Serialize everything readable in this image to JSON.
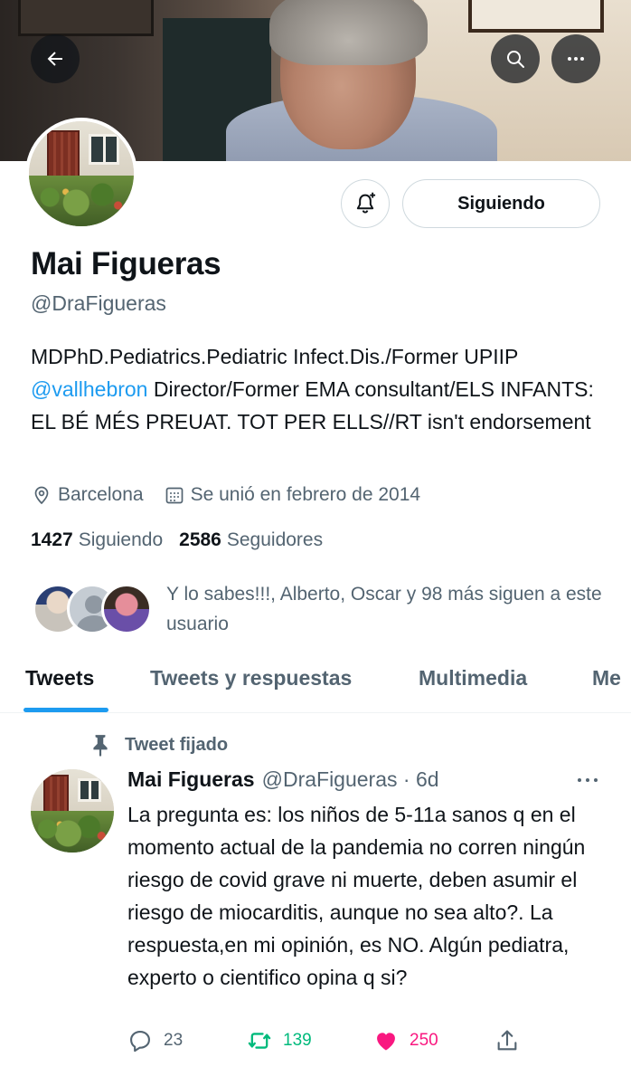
{
  "profile": {
    "name": "Mai Figueras",
    "handle": "@DraFigueras",
    "bio_before": "MDPhD.Pediatrics.Pediatric Infect.Dis./Former UPIIP ",
    "bio_mention": "@vallhebron",
    "bio_after": " Director/Former EMA consultant/ELS INFANTS: EL BÉ MÉS PREUAT. TOT PER ELLS//RT isn't endorsement",
    "location": "Barcelona",
    "joined": "Se unió en febrero de 2014",
    "following_count": "1427",
    "following_label": "Siguiendo",
    "followers_count": "2586",
    "followers_label": "Seguidores",
    "known_followers_text": "Y lo sabes!!!, Alberto, Oscar y 98 más siguen a este usuario"
  },
  "header": {
    "back_icon": "arrow-left-icon",
    "search_icon": "search-icon",
    "more_icon": "more-horizontal-icon"
  },
  "buttons": {
    "notify_icon": "bell-plus-icon",
    "follow_label": "Siguiendo"
  },
  "tabs": [
    {
      "label": "Tweets",
      "active": true
    },
    {
      "label": "Tweets y respuestas",
      "active": false
    },
    {
      "label": "Multimedia",
      "active": false
    },
    {
      "label": "Me",
      "active": false
    }
  ],
  "tweet": {
    "pinned_label": "Tweet fijado",
    "author_name": "Mai Figueras",
    "author_handle": "@DraFigueras · 6d",
    "text": "La pregunta es: los niños de 5-11a sanos q en el momento actual de la pandemia no corren ningún riesgo de covid grave ni muerte, deben asumir el riesgo de miocarditis, aunque no sea alto?. La respuesta,en mi opinión, es NO. Algún pediatra, experto o cientifico opina q si?",
    "replies": "23",
    "retweets": "139",
    "likes": "250"
  },
  "colors": {
    "accent": "#1d9bf0",
    "retweet": "#00ba7c",
    "like": "#f91880",
    "secondary_text": "#536471"
  }
}
